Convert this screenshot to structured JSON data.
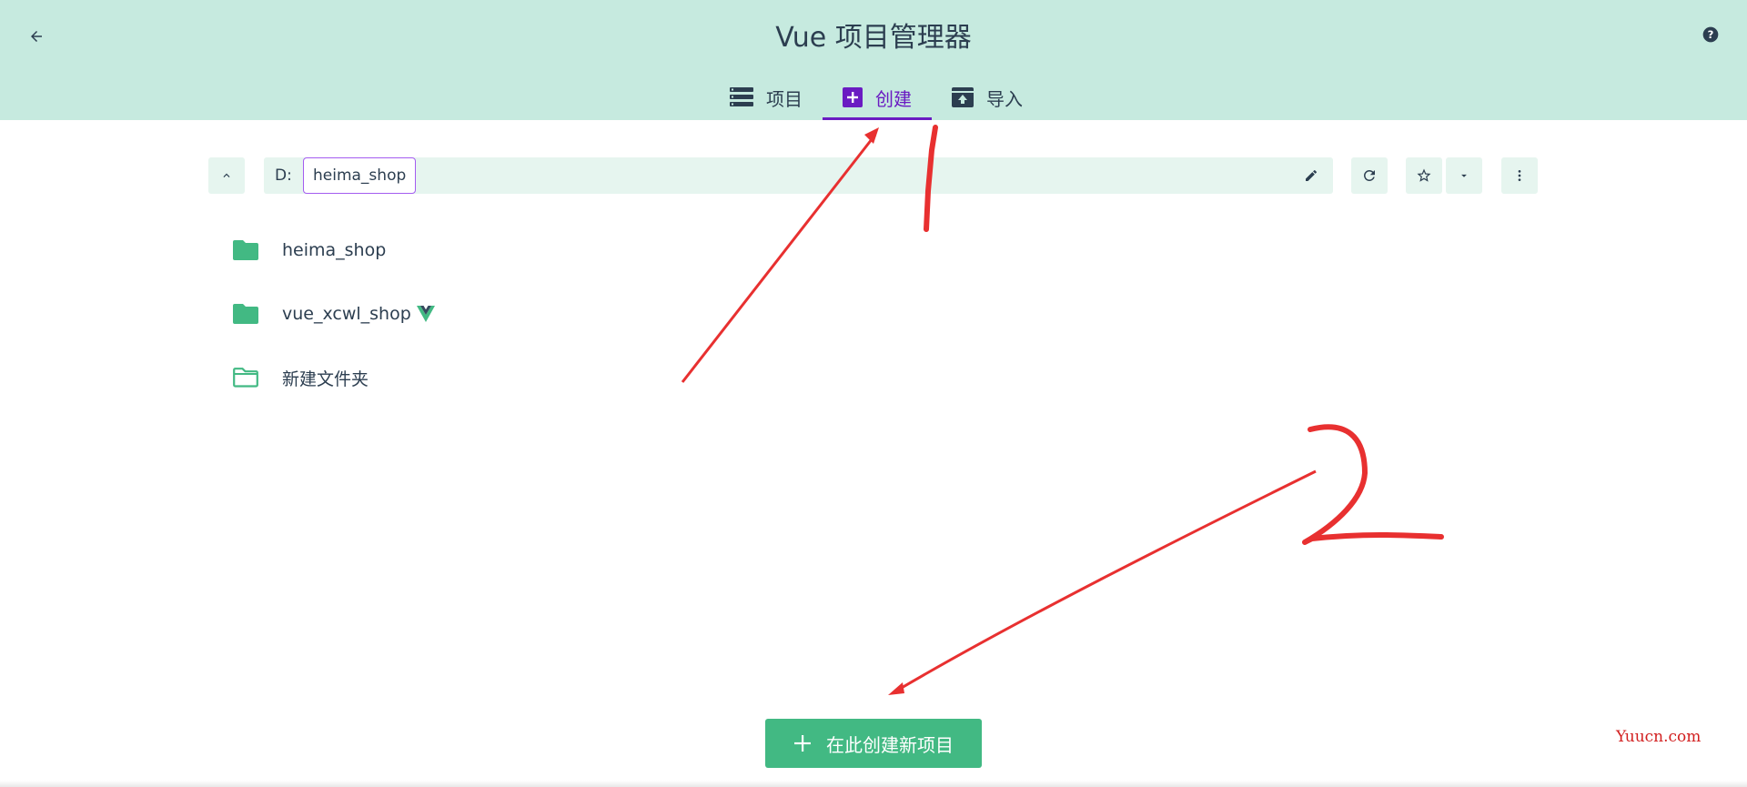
{
  "header": {
    "title": "Vue 项目管理器",
    "tabs": [
      {
        "label": "项目",
        "icon": "list-icon",
        "active": false
      },
      {
        "label": "创建",
        "icon": "plus-box-icon",
        "active": true
      },
      {
        "label": "导入",
        "icon": "archive-upload-icon",
        "active": false
      }
    ]
  },
  "path_bar": {
    "drive": "D:",
    "current_folder": "heima_shop"
  },
  "folders": [
    {
      "name": "heima_shop",
      "icon": "folder-icon",
      "vue_project": false
    },
    {
      "name": "vue_xcwl_shop",
      "icon": "folder-icon",
      "vue_project": true
    },
    {
      "name": "新建文件夹",
      "icon": "folder-outline-icon",
      "vue_project": false
    }
  ],
  "create_button": {
    "label": "在此创建新项目"
  },
  "annotations": {
    "one": "1",
    "two": "2"
  },
  "watermark": "Yuucn.com",
  "colors": {
    "header_bg": "#c6eadf",
    "accent_green": "#42b983",
    "active_tab": "#6a1bc2",
    "annotation_red": "#e83030"
  }
}
